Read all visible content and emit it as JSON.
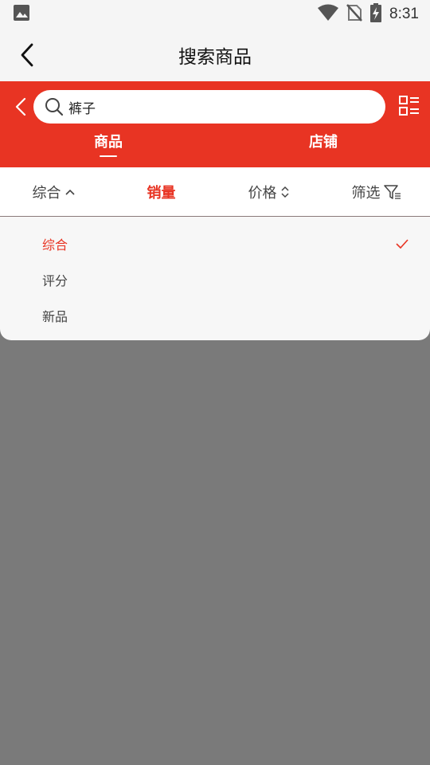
{
  "status": {
    "time": "8:31"
  },
  "header": {
    "title": "搜索商品"
  },
  "search": {
    "query": "裤子"
  },
  "tabs": [
    {
      "label": "商品"
    },
    {
      "label": "店铺"
    }
  ],
  "sort": {
    "items": [
      {
        "label": "综合"
      },
      {
        "label": "销量"
      },
      {
        "label": "价格"
      },
      {
        "label": "筛选"
      }
    ]
  },
  "dropdown": {
    "options": [
      {
        "label": "综合"
      },
      {
        "label": "评分"
      },
      {
        "label": "新品"
      }
    ]
  },
  "colors": {
    "accent": "#e83423",
    "overlay": "#7a7a7a"
  },
  "icons": [
    "image-icon",
    "wifi-icon",
    "no-sim-icon",
    "battery-charging-icon",
    "back-arrow-icon",
    "search-icon",
    "list-layout-icon",
    "chevron-up-icon",
    "sort-updown-icon",
    "filter-icon",
    "check-icon"
  ]
}
